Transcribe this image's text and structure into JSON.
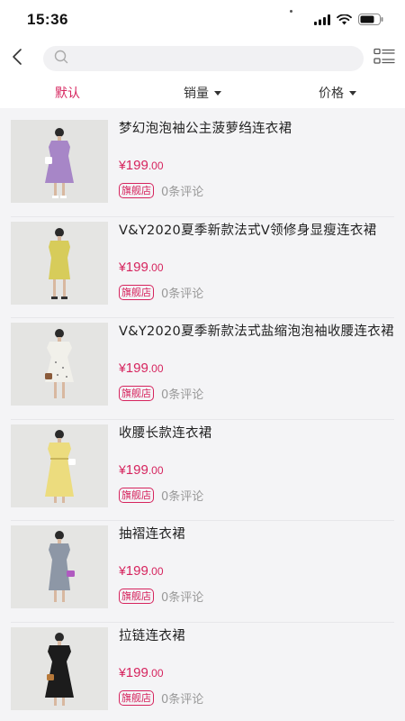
{
  "status_bar": {
    "time": "15:36"
  },
  "search": {
    "value": "",
    "placeholder": ""
  },
  "sort_tabs": [
    {
      "label": "默认"
    },
    {
      "label": "销量"
    },
    {
      "label": "价格"
    }
  ],
  "products": [
    {
      "title": "梦幻泡泡袖公主菠萝绉连衣裙",
      "currency": "¥",
      "price_int": "199",
      "price_dec": ".00",
      "badge": "旗舰店",
      "comments": "0条评论",
      "dress_color": "#a786c7"
    },
    {
      "title": "V&Y2020夏季新款法式V领修身显瘦连衣裙",
      "currency": "¥",
      "price_int": "199",
      "price_dec": ".00",
      "badge": "旗舰店",
      "comments": "0条评论",
      "dress_color": "#d7cc5a"
    },
    {
      "title": "V&Y2020夏季新款法式盐缩泡泡袖收腰连衣裙",
      "currency": "¥",
      "price_int": "199",
      "price_dec": ".00",
      "badge": "旗舰店",
      "comments": "0条评论",
      "dress_color": "#f1f0ea"
    },
    {
      "title": "收腰长款连衣裙",
      "currency": "¥",
      "price_int": "199",
      "price_dec": ".00",
      "badge": "旗舰店",
      "comments": "0条评论",
      "dress_color": "#ecdc7e"
    },
    {
      "title": "抽褶连衣裙",
      "currency": "¥",
      "price_int": "199",
      "price_dec": ".00",
      "badge": "旗舰店",
      "comments": "0条评论",
      "dress_color": "#8d97a6"
    },
    {
      "title": "拉链连衣裙",
      "currency": "¥",
      "price_int": "199",
      "price_dec": ".00",
      "badge": "旗舰店",
      "comments": "0条评论",
      "dress_color": "#1c1c1c"
    }
  ],
  "colors": {
    "accent": "#d6245e"
  }
}
